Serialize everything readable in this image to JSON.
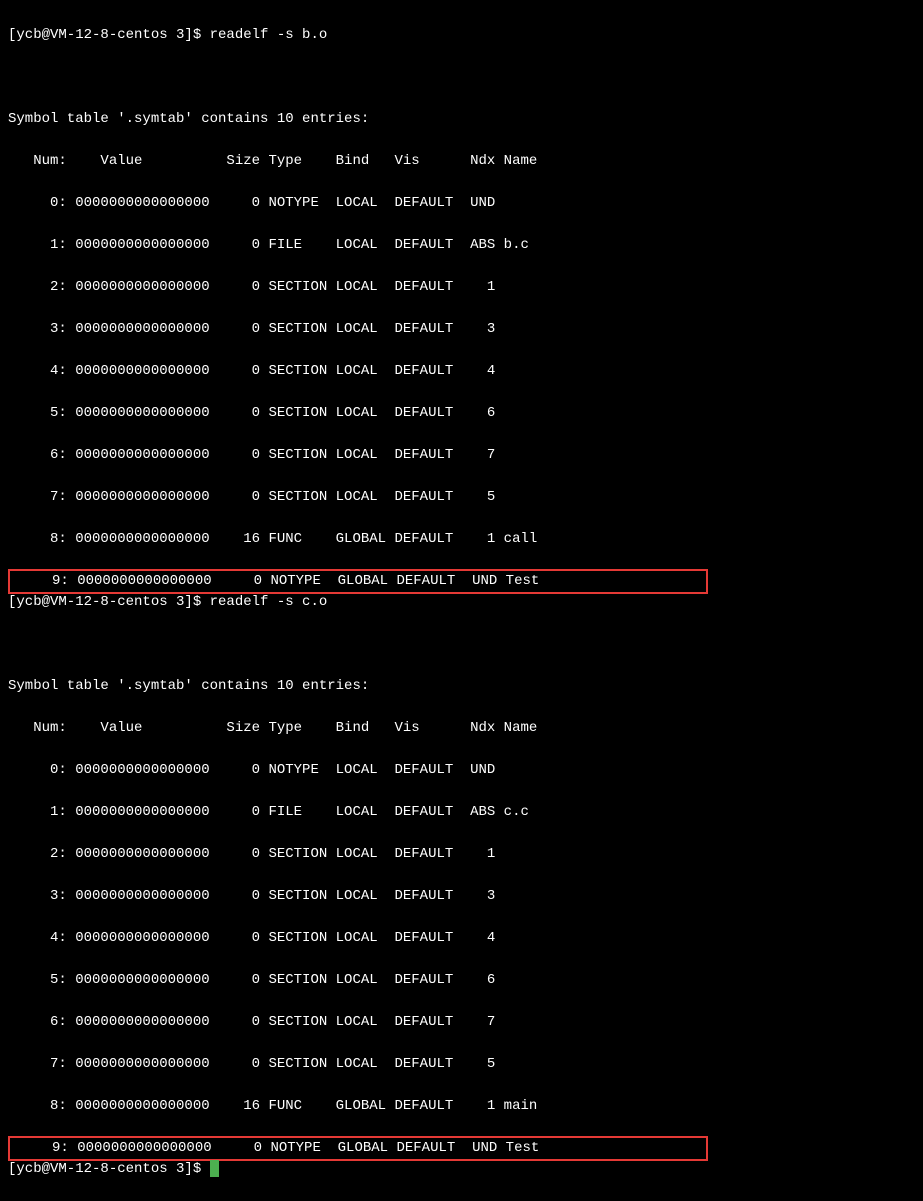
{
  "block1": {
    "prompt": "[ycb@VM-12-8-centos 3]$ readelf -s b.o",
    "title": "Symbol table '.symtab' contains 10 entries:",
    "header": "   Num:    Value          Size Type    Bind   Vis      Ndx Name",
    "rows": [
      "     0: 0000000000000000     0 NOTYPE  LOCAL  DEFAULT  UND ",
      "     1: 0000000000000000     0 FILE    LOCAL  DEFAULT  ABS b.c",
      "     2: 0000000000000000     0 SECTION LOCAL  DEFAULT    1 ",
      "     3: 0000000000000000     0 SECTION LOCAL  DEFAULT    3 ",
      "     4: 0000000000000000     0 SECTION LOCAL  DEFAULT    4 ",
      "     5: 0000000000000000     0 SECTION LOCAL  DEFAULT    6 ",
      "     6: 0000000000000000     0 SECTION LOCAL  DEFAULT    7 ",
      "     7: 0000000000000000     0 SECTION LOCAL  DEFAULT    5 ",
      "     8: 0000000000000000    16 FUNC    GLOBAL DEFAULT    1 call"
    ],
    "highlighted_row": "     9: 0000000000000000     0 NOTYPE  GLOBAL DEFAULT  UND Test"
  },
  "block2": {
    "prompt": "[ycb@VM-12-8-centos 3]$ readelf -s c.o",
    "title": "Symbol table '.symtab' contains 10 entries:",
    "header": "   Num:    Value          Size Type    Bind   Vis      Ndx Name",
    "rows": [
      "     0: 0000000000000000     0 NOTYPE  LOCAL  DEFAULT  UND ",
      "     1: 0000000000000000     0 FILE    LOCAL  DEFAULT  ABS c.c",
      "     2: 0000000000000000     0 SECTION LOCAL  DEFAULT    1 ",
      "     3: 0000000000000000     0 SECTION LOCAL  DEFAULT    3 ",
      "     4: 0000000000000000     0 SECTION LOCAL  DEFAULT    4 ",
      "     5: 0000000000000000     0 SECTION LOCAL  DEFAULT    6 ",
      "     6: 0000000000000000     0 SECTION LOCAL  DEFAULT    7 ",
      "     7: 0000000000000000     0 SECTION LOCAL  DEFAULT    5 ",
      "     8: 0000000000000000    16 FUNC    GLOBAL DEFAULT    1 main"
    ],
    "highlighted_row": "     9: 0000000000000000     0 NOTYPE  GLOBAL DEFAULT  UND Test"
  },
  "final_prompt": "[ycb@VM-12-8-centos 3]$ "
}
